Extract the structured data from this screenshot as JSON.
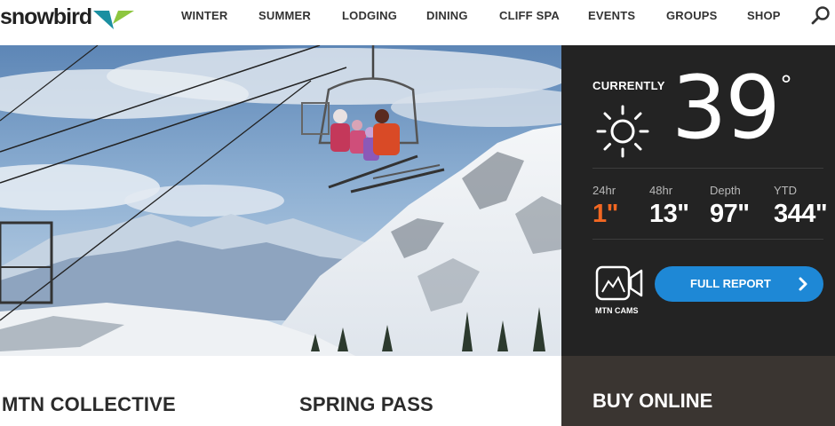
{
  "brand": {
    "name": "snowbird",
    "colors": {
      "bird_teal": "#1b8fa1",
      "bird_green": "#8dc63f",
      "accent_orange": "#f26722",
      "button_blue": "#1e88d6",
      "panel_dark": "#232323",
      "panel_brown": "#3a3531"
    }
  },
  "nav": {
    "items": [
      "WINTER",
      "SUMMER",
      "LODGING",
      "DINING",
      "CLIFF SPA",
      "EVENTS",
      "GROUPS",
      "SHOP"
    ],
    "search_icon": "search-icon"
  },
  "hero": {
    "image": "chairlift-skiers-snowy-mountains"
  },
  "weather": {
    "currently_label": "CURRENTLY",
    "condition_icon": "sun-icon",
    "temperature": "39",
    "degree_symbol": "°",
    "stats": [
      {
        "label": "24hr",
        "value": "1\""
      },
      {
        "label": "48hr",
        "value": "13\""
      },
      {
        "label": "Depth",
        "value": "97\""
      },
      {
        "label": "YTD",
        "value": "344\""
      }
    ],
    "cams_label": "MTN CAMS",
    "cams_icon": "camera-icon",
    "report_button": "FULL REPORT"
  },
  "promos": {
    "left": "MTN COLLECTIVE",
    "middle": "SPRING PASS",
    "buy": "BUY ONLINE"
  }
}
